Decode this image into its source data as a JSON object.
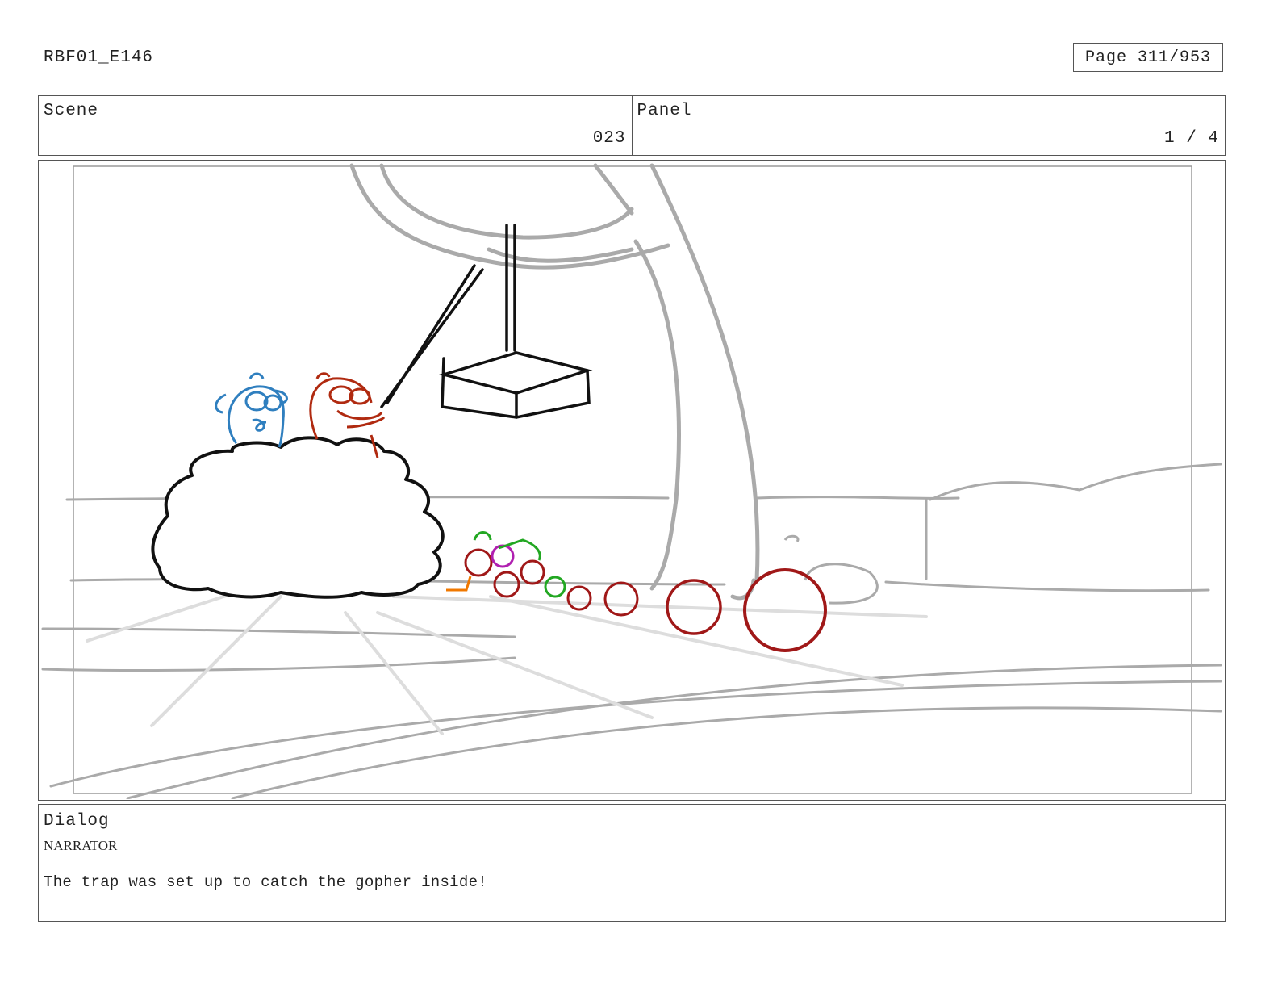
{
  "header": {
    "doc_id": "RBF01_E146",
    "page": "Page 311/953"
  },
  "info": {
    "scene_label": "Scene",
    "scene_value": "023",
    "panel_label": "Panel",
    "panel_value": "1 / 4"
  },
  "drawing": {
    "gopher_blue_color": "#2f7fbf",
    "gopher_red_color": "#b02a10",
    "fruit_color": "#a01818",
    "background_line_color": "#aaaaaa"
  },
  "dialog": {
    "label": "Dialog",
    "speaker": "NARRATOR",
    "line": "The trap was set up to catch the gopher inside!"
  }
}
